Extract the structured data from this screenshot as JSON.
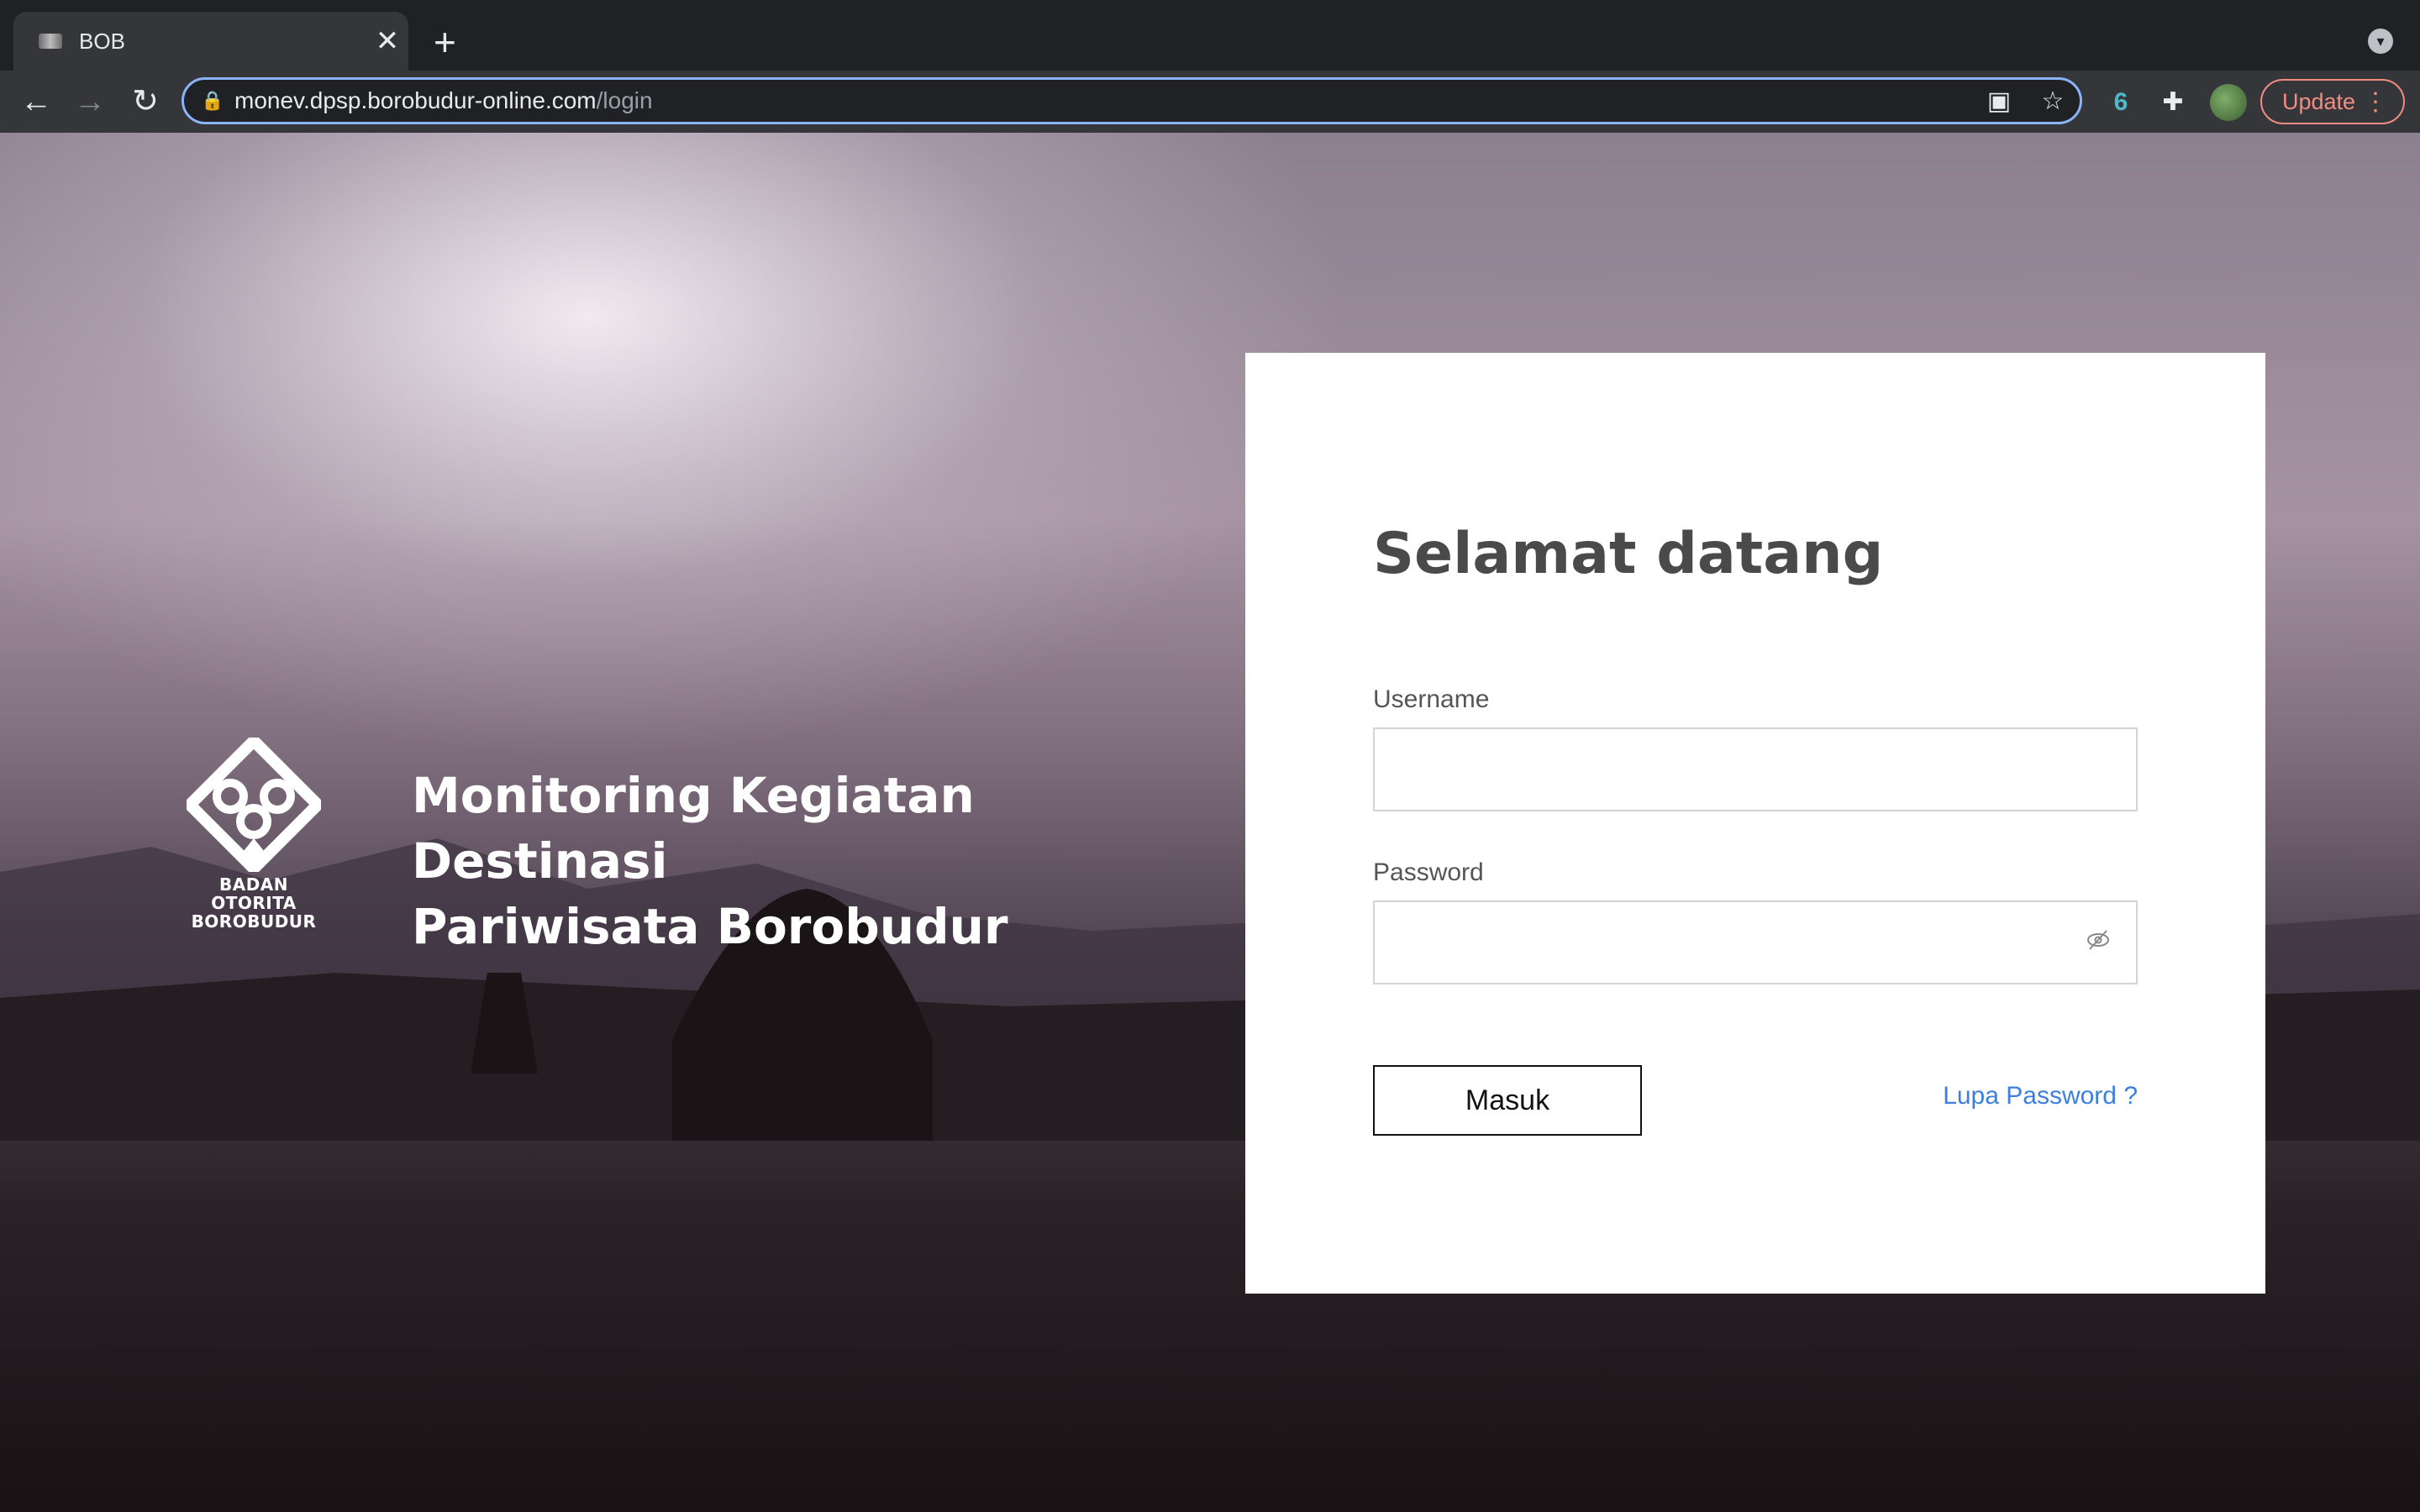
{
  "browser": {
    "tab_title": "BOB",
    "tab_close": "✕",
    "new_tab": "+",
    "url_host": "monev.dpsp.borobudur-online.com",
    "url_path": "/login",
    "update_label": "Update",
    "icons": [
      "back-icon",
      "forward-icon",
      "reload-icon",
      "lock-icon",
      "qr-code-icon",
      "star-icon",
      "extension-6-icon",
      "puzzle-icon",
      "avatar",
      "menu-dots-icon",
      "tab-search-icon"
    ]
  },
  "hero": {
    "logo_caption_line1": "BADAN OTORITA",
    "logo_caption_line2": "BOROBUDUR",
    "title_line1": "Monitoring Kegiatan Destinasi",
    "title_line2": "Pariwisata Borobudur"
  },
  "login": {
    "heading": "Selamat datang",
    "username_label": "Username",
    "username_value": "",
    "password_label": "Password",
    "password_value": "",
    "submit_label": "Masuk",
    "forgot_label": "Lupa Password ?"
  },
  "colors": {
    "chrome_dark": "#202124",
    "chrome_toolbar": "#35363a",
    "focus_ring": "#8ab4f8",
    "update_red": "#f28b82",
    "link_blue": "#3b7fe0",
    "heading_gray": "#4a4a4a"
  }
}
